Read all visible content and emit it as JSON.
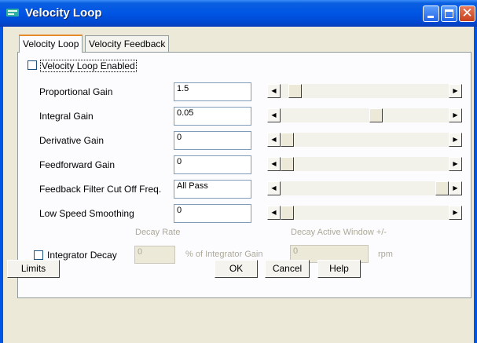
{
  "window": {
    "title": "Velocity Loop",
    "icon": "app-icon"
  },
  "tabs": [
    {
      "label": "Velocity Loop",
      "active": true
    },
    {
      "label": "Velocity Feedback",
      "active": false
    }
  ],
  "velocity_loop_enabled": {
    "label": "Velocity Loop Enabled",
    "checked": false
  },
  "rows": [
    {
      "label": "Proportional Gain",
      "value": "1.5",
      "slider_position": 0.03
    },
    {
      "label": "Integral Gain",
      "value": "0.05",
      "slider_position": 0.53
    },
    {
      "label": "Derivative Gain",
      "value": "0",
      "slider_position": 0.0
    },
    {
      "label": "Feedforward Gain",
      "value": "0",
      "slider_position": 0.0
    },
    {
      "label": "Feedback Filter Cut Off Freq.",
      "value": "All Pass",
      "slider_position": 1.0
    },
    {
      "label": "Low Speed Smoothing",
      "value": "0",
      "slider_position": 0.0
    }
  ],
  "decay": {
    "decay_rate_header": "Decay Rate",
    "active_window_header": "Decay Active Window +/-",
    "integrator_decay_label": "Integrator Decay",
    "integrator_decay_checked": false,
    "decay_rate_value": "0",
    "decay_rate_unit": "% of Integrator Gain",
    "active_window_value": "0",
    "active_window_unit": "rpm"
  },
  "buttons": {
    "limits": "Limits",
    "ok": "OK",
    "cancel": "Cancel",
    "help": "Help"
  },
  "colors": {
    "titlebar": "#0055e5",
    "dialog_bg": "#ece9d8",
    "panel_bg": "#fcfcfe",
    "disabled_text": "#aca899"
  }
}
